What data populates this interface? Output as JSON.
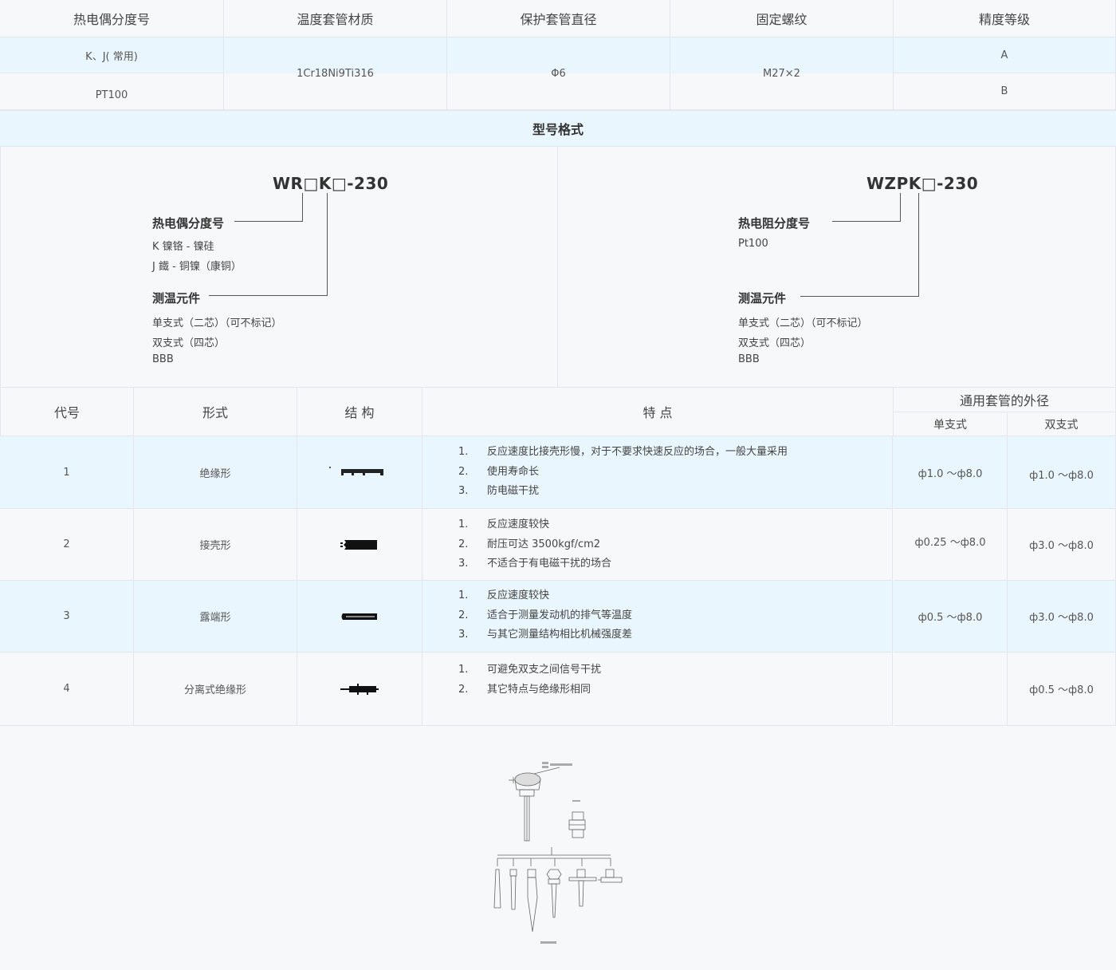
{
  "spec_table": {
    "headers": [
      "热电偶分度号",
      "温度套管材质",
      "保护套管直径",
      "固定螺纹",
      "精度等级"
    ],
    "grade_1": "K、J( 常用)",
    "grade_2": "PT100",
    "material": "1Cr18Ni9Ti316",
    "diameter": "Φ6",
    "thread": "M27×2",
    "accuracy_1": "A",
    "accuracy_2": "B"
  },
  "model_format": {
    "title": "型号格式",
    "left": {
      "code": "WR□K□-230",
      "label1": "热电偶分度号",
      "options1": [
        "K 镍铬 - 镍硅",
        "J 鐵 - 铜镍（康铜）"
      ],
      "label2": "测温元件",
      "options2": [
        "单支式（二芯）（可不标记）",
        "双支式（四芯）",
        "BBB"
      ]
    },
    "right": {
      "code": "WZPK□-230",
      "label1": "热电阻分度号",
      "options1": [
        "Pt100"
      ],
      "label2": "测温元件",
      "options2": [
        "单支式（二芯）（可不标记）",
        "双支式（四芯）",
        "BBB"
      ]
    }
  },
  "types_table": {
    "headers": {
      "code": "代号",
      "form": "形式",
      "structure": "结 构",
      "features": "特 点",
      "outer_diameter": "通用套管的外径",
      "single": "单支式",
      "double": "双支式"
    },
    "rows": [
      {
        "code": "1",
        "form": "绝缘形",
        "features": [
          "反应速度比接壳形慢，对于不要求快速反应的场合，一般大量采用",
          "使用寿命长",
          "防电磁干扰"
        ],
        "single": "ф1.0 ～ф8.0",
        "double": "ф1.0 ～ф8.0"
      },
      {
        "code": "2",
        "form": "接壳形",
        "features": [
          "反应速度较快",
          "耐压可达 3500kgf/cm2",
          "不适合于有电磁干扰的场合"
        ],
        "single": "ф0.25 ～ф8.0",
        "double": "ф3.0 ～ф8.0"
      },
      {
        "code": "3",
        "form": "露端形",
        "features": [
          "反应速度较快",
          "适合于测量发动机的排气等温度",
          "与其它测量结构相比机械强度差"
        ],
        "single": "ф0.5 ～ф8.0",
        "double": "ф3.0 ～ф8.0"
      },
      {
        "code": "4",
        "form": "分离式绝缘形",
        "features": [
          "可避免双支之间信号干扰",
          "其它特点与绝缘形相同"
        ],
        "single": "",
        "double": "ф0.5 ～ф8.0"
      }
    ]
  },
  "colors": {
    "highlight_row": "#eaf6fd",
    "border": "#e3e6ea",
    "background": "#f7f8fa"
  }
}
